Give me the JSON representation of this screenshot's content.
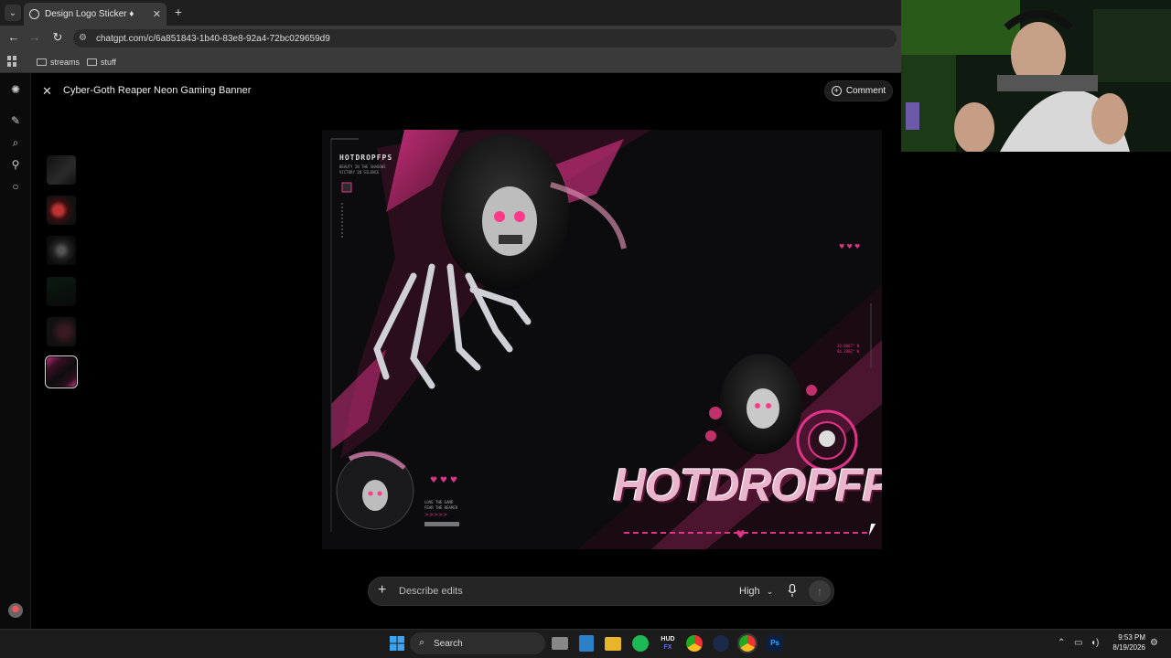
{
  "browser": {
    "tab_title": "Design Logo Sticker ♦",
    "url": "chatgpt.com/c/6a851843-1b40-83e8-92a4-72bc029659d9",
    "bookmarks": [
      {
        "label": "streams"
      },
      {
        "label": "stuff"
      }
    ]
  },
  "header": {
    "title": "Cyber-Goth Reaper Neon Gaming Banner",
    "comment_label": "Comment"
  },
  "banner": {
    "brand_small": "HOTDROPFPS",
    "tagline1": "BEAUTY IN THE SHADOWS",
    "tagline2": "VICTORY IN SILENCE",
    "coords1": "33.8667° N",
    "coords2": "84.3902° W",
    "love1": "LOVE THE GAME",
    "love2": "FEAR THE REAPER",
    "logo_text": "HOTDROPFPS",
    "colors": {
      "accent": "#e0348a",
      "bg": "#0c0c0e"
    }
  },
  "prompt": {
    "placeholder": "Describe edits",
    "quality": "High"
  },
  "taskbar": {
    "search_label": "Search",
    "time": "9:53 PM",
    "date": "8/19/2026"
  }
}
